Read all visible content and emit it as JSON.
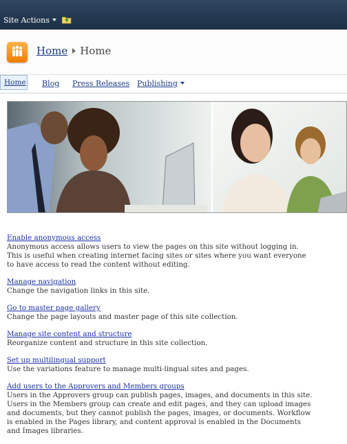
{
  "topbar": {
    "site_actions_label": "Site Actions"
  },
  "breadcrumb": {
    "home_link": "Home",
    "current": "Home"
  },
  "nav": {
    "tabs": [
      {
        "label": "Home"
      },
      {
        "label": "Blog"
      },
      {
        "label": "Press Releases"
      },
      {
        "label": "Publishing"
      }
    ]
  },
  "colors": {
    "topbar": "#23384f",
    "link": "#1a2faa",
    "logo": "#f59a1b"
  },
  "tasks": [
    {
      "title": "Enable anonymous access",
      "description": "Anonymous access allows users to view the pages on this site without logging in. This is useful when creating internet facing sites or sites where you want everyone to have access to read the content without editing."
    },
    {
      "title": "Manage navigation",
      "description": "Change the navigation links in this site."
    },
    {
      "title": "Go to master page gallery",
      "description": "Change the page layouts and master page of this site collection."
    },
    {
      "title": "Manage site content and structure",
      "description": "Reorganize content and structure in this site collection."
    },
    {
      "title": "Set up multilingual support",
      "description": "Use the variations feature to manage multi-lingual sites and pages."
    },
    {
      "title": "Add users to the Approvers and Members groups",
      "description": "Users in the Approvers group can publish pages, images, and documents in this site. Users in the Members group can create and edit pages, and they can upload images and documents, but they cannot publish the pages, images, or documents. Workflow is enabled in the Pages library, and content approval is enabled in the Documents and Images libraries."
    }
  ]
}
